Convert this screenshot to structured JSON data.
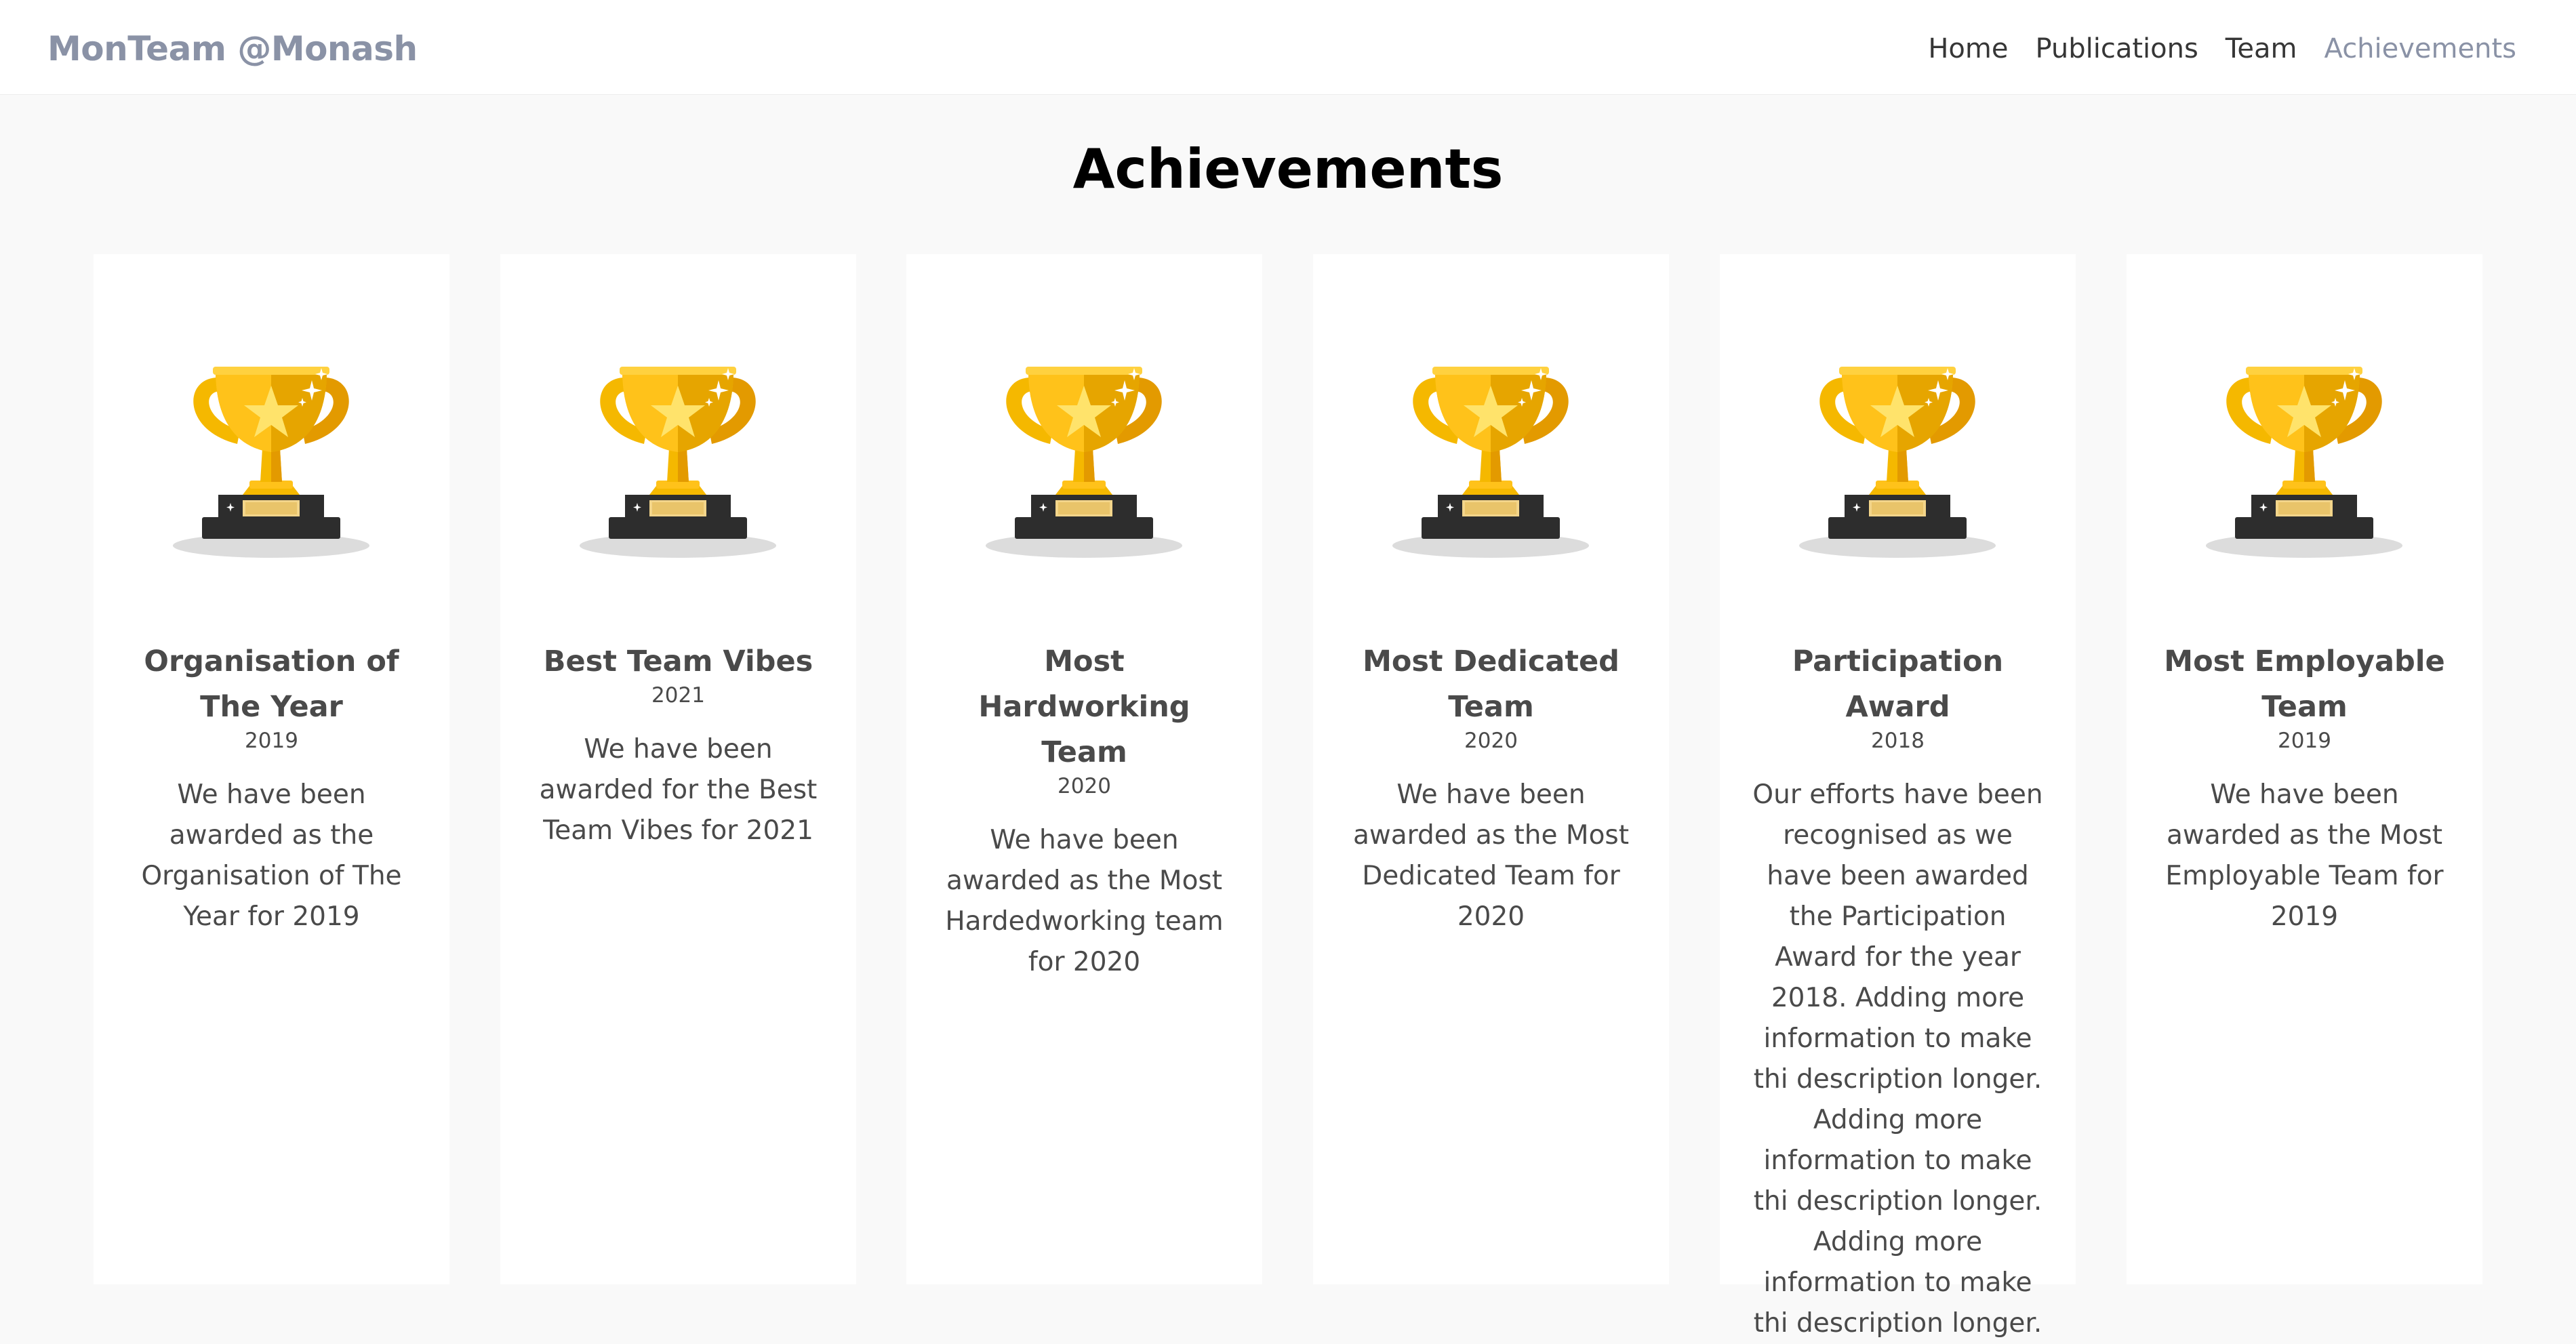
{
  "brand": "MonTeam @Monash",
  "nav": {
    "links": [
      "Home",
      "Publications",
      "Team",
      "Achievements"
    ],
    "active": "Achievements"
  },
  "page_title": "Achievements",
  "colors": {
    "trophy_gold": "#f5b800",
    "trophy_light": "#ffd13f",
    "trophy_dark": "#e39a00",
    "base": "#2d2d2d",
    "plaque": "#f3d58a",
    "shadow": "#dcdcdc",
    "brand": "#8a92a6",
    "background": "#f9f9f9"
  },
  "icons": {
    "trophy": "trophy-icon"
  },
  "achievements": [
    {
      "title": "Organisation of The Year",
      "year": "2019",
      "description": "We have been awarded as the Organisation of The Year for 2019"
    },
    {
      "title": "Best Team Vibes",
      "year": "2021",
      "description": "We have been awarded for the Best Team Vibes for 2021"
    },
    {
      "title": "Most Hardworking Team",
      "year": "2020",
      "description": "We have been awarded as the Most Hardedworking team for 2020"
    },
    {
      "title": "Most Dedicated Team",
      "year": "2020",
      "description": "We have been awarded as the Most Dedicated Team for 2020"
    },
    {
      "title": "Participation Award",
      "year": "2018",
      "description": "Our efforts have been recognised as we have been awarded the Participation Award for the year 2018. Adding more information to make thi description longer. Adding more information to make thi description longer. Adding more information to make thi description longer."
    },
    {
      "title": "Most Employable Team",
      "year": "2019",
      "description": "We have been awarded as the Most Employable Team for 2019"
    }
  ]
}
